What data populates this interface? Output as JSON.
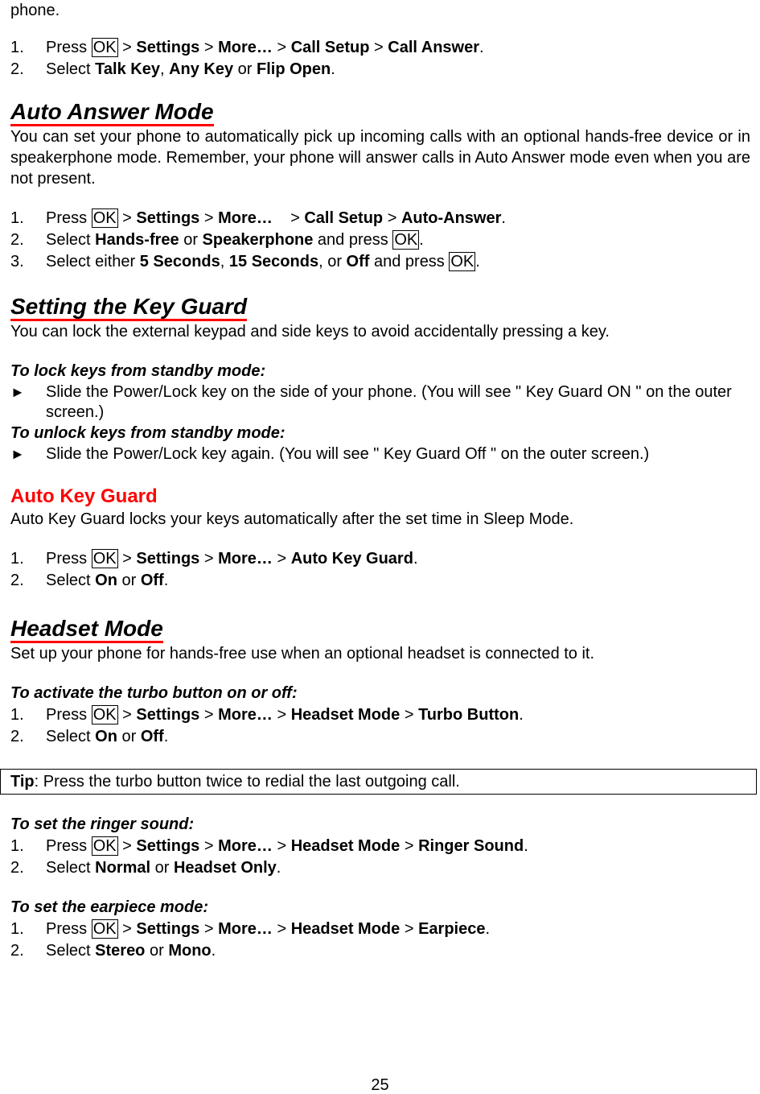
{
  "intro_tail": "phone.",
  "call_answer": {
    "steps": [
      {
        "num": "1.",
        "segs": [
          [
            "t",
            "Press "
          ],
          [
            "k",
            "OK"
          ],
          [
            "t",
            " > "
          ],
          [
            "b",
            "Settings"
          ],
          [
            "t",
            " > "
          ],
          [
            "b",
            "More…"
          ],
          [
            "t",
            " > "
          ],
          [
            "b",
            "Call Setup"
          ],
          [
            "t",
            " > "
          ],
          [
            "b",
            "Call Answer"
          ],
          [
            "t",
            "."
          ]
        ]
      },
      {
        "num": "2.",
        "segs": [
          [
            "t",
            "Select "
          ],
          [
            "b",
            "Talk Key"
          ],
          [
            "t",
            ", "
          ],
          [
            "b",
            "Any Key"
          ],
          [
            "t",
            " or "
          ],
          [
            "b",
            "Flip Open"
          ],
          [
            "t",
            "."
          ]
        ]
      }
    ]
  },
  "auto_answer": {
    "title": "Auto Answer Mode",
    "body": "You can set your phone to automatically pick up incoming calls with an optional hands-free device or in speakerphone mode. Remember, your phone will answer calls in Auto Answer mode even when you are not present.",
    "steps": [
      {
        "num": "1.",
        "segs": [
          [
            "t",
            "Press "
          ],
          [
            "k",
            "OK"
          ],
          [
            "t",
            " > "
          ],
          [
            "b",
            "Settings"
          ],
          [
            "t",
            " > "
          ],
          [
            "b",
            "More…"
          ],
          [
            "t",
            "    > "
          ],
          [
            "b",
            "Call Setup"
          ],
          [
            "t",
            " > "
          ],
          [
            "b",
            "Auto-Answer"
          ],
          [
            "t",
            "."
          ]
        ]
      },
      {
        "num": "2.",
        "segs": [
          [
            "t",
            "Select "
          ],
          [
            "b",
            "Hands-free"
          ],
          [
            "t",
            " or "
          ],
          [
            "b",
            "Speakerphone"
          ],
          [
            "t",
            " and press "
          ],
          [
            "k",
            "OK"
          ],
          [
            "t",
            "."
          ]
        ]
      },
      {
        "num": "3.",
        "segs": [
          [
            "t",
            "Select either "
          ],
          [
            "b",
            "5 Seconds"
          ],
          [
            "t",
            ", "
          ],
          [
            "b",
            "15 Seconds"
          ],
          [
            "t",
            ", or "
          ],
          [
            "b",
            "Off"
          ],
          [
            "t",
            " and press "
          ],
          [
            "k",
            "OK"
          ],
          [
            "t",
            "."
          ]
        ]
      }
    ]
  },
  "key_guard": {
    "title": "Setting the Key Guard",
    "body": "You can lock the external keypad and side keys to avoid accidentally pressing a key.",
    "lock_heading": "To lock keys from standby mode:",
    "lock_bullet": "Slide the Power/Lock key on the side of your phone. (You will see \" Key Guard ON \" on the outer screen.)",
    "unlock_heading": "To unlock keys from standby mode:",
    "unlock_bullet": "Slide the Power/Lock key again. (You will see \" Key Guard Off \" on the outer screen.)",
    "bullet_marker": "►"
  },
  "auto_key_guard": {
    "title": "Auto Key Guard",
    "body": "Auto Key Guard locks your keys automatically after the set time in Sleep Mode.",
    "steps": [
      {
        "num": "1.",
        "segs": [
          [
            "t",
            "Press "
          ],
          [
            "k",
            "OK"
          ],
          [
            "t",
            " > "
          ],
          [
            "b",
            "Settings"
          ],
          [
            "t",
            " > "
          ],
          [
            "b",
            "More…"
          ],
          [
            "t",
            " > "
          ],
          [
            "b",
            "Auto Key Guard"
          ],
          [
            "t",
            "."
          ]
        ]
      },
      {
        "num": "2.",
        "segs": [
          [
            "t",
            "Select "
          ],
          [
            "b",
            "On"
          ],
          [
            "t",
            " or "
          ],
          [
            "b",
            "Off"
          ],
          [
            "t",
            "."
          ]
        ]
      }
    ]
  },
  "headset_mode": {
    "title": "Headset Mode",
    "body": "Set up your phone for hands-free use when an optional headset is connected to it.",
    "turbo_heading": "To activate the turbo button on or off:",
    "turbo_steps": [
      {
        "num": "1.",
        "segs": [
          [
            "t",
            "Press "
          ],
          [
            "k",
            "OK"
          ],
          [
            "t",
            " > "
          ],
          [
            "b",
            "Settings"
          ],
          [
            "t",
            " > "
          ],
          [
            "b",
            "More…"
          ],
          [
            "t",
            " > "
          ],
          [
            "b",
            "Headset Mode"
          ],
          [
            "t",
            " > "
          ],
          [
            "b",
            "Turbo Button"
          ],
          [
            "t",
            "."
          ]
        ]
      },
      {
        "num": "2.",
        "segs": [
          [
            "t",
            "Select "
          ],
          [
            "b",
            "On"
          ],
          [
            "t",
            " or "
          ],
          [
            "b",
            "Off"
          ],
          [
            "t",
            "."
          ]
        ]
      }
    ],
    "tip_label": "Tip",
    "tip_text": ": Press the turbo button twice to redial the last outgoing call.",
    "ringer_heading": "To set the ringer sound:",
    "ringer_steps": [
      {
        "num": "1.",
        "segs": [
          [
            "t",
            "Press "
          ],
          [
            "k",
            "OK"
          ],
          [
            "t",
            " > "
          ],
          [
            "b",
            "Settings"
          ],
          [
            "t",
            " > "
          ],
          [
            "b",
            "More…"
          ],
          [
            "t",
            " > "
          ],
          [
            "b",
            "Headset Mode"
          ],
          [
            "t",
            " > "
          ],
          [
            "b",
            "Ringer Sound"
          ],
          [
            "t",
            "."
          ]
        ]
      },
      {
        "num": "2.",
        "segs": [
          [
            "t",
            "Select "
          ],
          [
            "b",
            "Normal"
          ],
          [
            "t",
            " or "
          ],
          [
            "b",
            "Headset Only"
          ],
          [
            "t",
            "."
          ]
        ]
      }
    ],
    "earpiece_heading": "To set the earpiece mode:",
    "earpiece_steps": [
      {
        "num": "1.",
        "segs": [
          [
            "t",
            "Press "
          ],
          [
            "k",
            "OK"
          ],
          [
            "t",
            " > "
          ],
          [
            "b",
            "Settings"
          ],
          [
            "t",
            " > "
          ],
          [
            "b",
            "More…"
          ],
          [
            "t",
            " > "
          ],
          [
            "b",
            "Headset Mode"
          ],
          [
            "t",
            " > "
          ],
          [
            "b",
            "Earpiece"
          ],
          [
            "t",
            "."
          ]
        ]
      },
      {
        "num": "2.",
        "segs": [
          [
            "t",
            "Select "
          ],
          [
            "b",
            "Stereo"
          ],
          [
            "t",
            " or "
          ],
          [
            "b",
            "Mono"
          ],
          [
            "t",
            "."
          ]
        ]
      }
    ]
  },
  "page_number": "25"
}
